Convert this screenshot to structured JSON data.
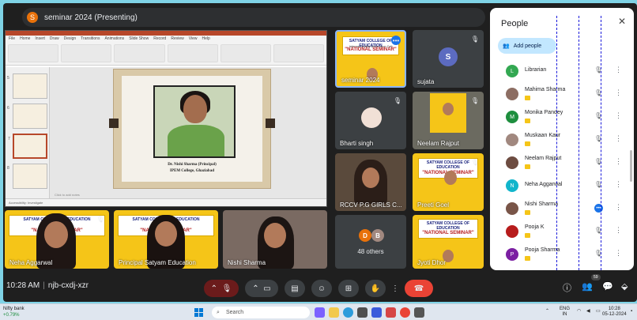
{
  "presentation": {
    "badge": "S",
    "title": "seminar 2024 (Presenting)"
  },
  "ppt": {
    "tabs": [
      "File",
      "Home",
      "Insert",
      "Draw",
      "Design",
      "Transitions",
      "Animations",
      "Slide Show",
      "Record",
      "Review",
      "View",
      "Help"
    ],
    "thumb_numbers": [
      "5",
      "6",
      "7",
      "8"
    ],
    "slide_caption1": "Dr. Nishi Sharma (Principal)",
    "slide_caption2": "IPEM College, Ghaziabad",
    "notes": "Click to add notes",
    "status": "Accessibility: Investigate"
  },
  "tiles": [
    {
      "name": "Neha Aggarwal"
    },
    {
      "name": "Principal Satyam Education"
    },
    {
      "name": "Nishi Sharma"
    },
    {
      "name": "seminar 2024"
    },
    {
      "name": "sujata",
      "initial": "S"
    },
    {
      "name": "Bharti singh"
    },
    {
      "name": "Neelam Rajput"
    },
    {
      "name": "RCCV P.G GIRLS C..."
    },
    {
      "name": "Preeti Goel"
    },
    {
      "name": "48 others",
      "initials": [
        "D",
        "B"
      ]
    },
    {
      "name": "Jyoti Dhor"
    }
  ],
  "banner": {
    "line1": "SATYAM COLLEGE OF EDUCATION",
    "line2": "Internal Quality Assurance Cell",
    "line3": "\"NATIONAL SEMINAR\""
  },
  "bottom": {
    "time": "10:28 AM",
    "code": "njb-cxdj-xzr",
    "people_count": "59"
  },
  "people_panel": {
    "title": "People",
    "add_label": "Add people",
    "participants": [
      {
        "name": "Librarian",
        "initial": "L",
        "color": "#33a852"
      },
      {
        "name": "Mahima Sharma",
        "initial": "",
        "color": "#8d6e63"
      },
      {
        "name": "Monika Pandey",
        "initial": "M",
        "color": "#1e8e3e"
      },
      {
        "name": "Muskaan Kaur",
        "initial": "",
        "color": "#a1887f"
      },
      {
        "name": "Neelam Rajput",
        "initial": "",
        "color": "#6d4c41"
      },
      {
        "name": "Neha Aggarwal",
        "initial": "N",
        "color": "#12b5cb"
      },
      {
        "name": "Nishi Sharma",
        "initial": "",
        "color": "#795548"
      },
      {
        "name": "Pooja K",
        "initial": "",
        "color": "#b71c1c"
      },
      {
        "name": "Pooja Sharma",
        "initial": "P",
        "color": "#7b1fa2"
      }
    ]
  },
  "taskbar": {
    "stock_name": "Nifty bank",
    "stock_change": "+0.79%",
    "search": "Search",
    "lang1": "ENG",
    "lang2": "IN",
    "clock_time": "10:28",
    "clock_date": "05-12-2024"
  }
}
